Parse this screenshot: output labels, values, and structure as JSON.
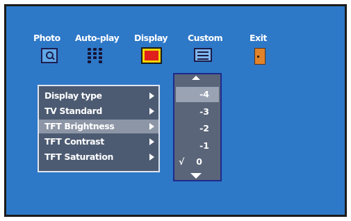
{
  "tabs": [
    {
      "label": "Photo",
      "icon": "magnifier-icon"
    },
    {
      "label": "Auto-play",
      "icon": "dots-icon"
    },
    {
      "label": "Display",
      "icon": "monitor-icon"
    },
    {
      "label": "Custom",
      "icon": "notepad-icon"
    },
    {
      "label": "Exit",
      "icon": "door-icon"
    }
  ],
  "active_tab": "Display",
  "menu": {
    "items": [
      {
        "label": "Display type"
      },
      {
        "label": "TV Standard"
      },
      {
        "label": "TFT Brightness"
      },
      {
        "label": "TFT Contrast"
      },
      {
        "label": "TFT Saturation"
      }
    ],
    "selected_index": 2
  },
  "values": {
    "options": [
      "-4",
      "-3",
      "-2",
      "-1",
      "0"
    ],
    "highlighted": "-4",
    "checked": "0",
    "check_mark": "√"
  },
  "colors": {
    "background": "#2e78c8",
    "menu_panel": "#4c5b72",
    "highlight": "#8d96a6",
    "value_border": "#1e2a8a"
  }
}
